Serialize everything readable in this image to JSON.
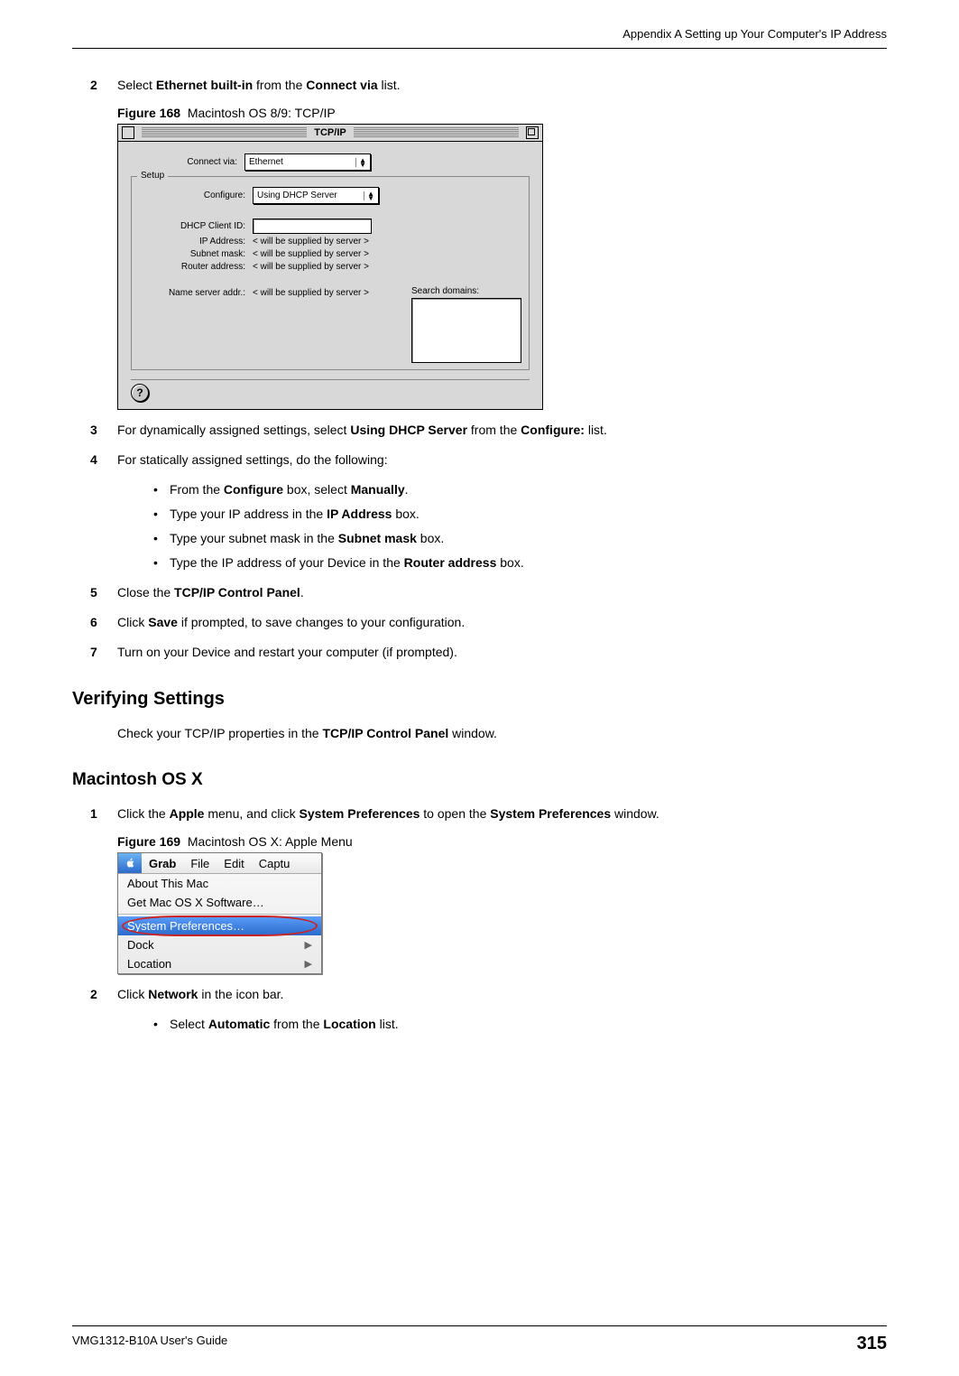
{
  "header": {
    "appendix": "Appendix A Setting up Your Computer's IP Address"
  },
  "steps": {
    "s2": {
      "num": "2",
      "pre": "Select ",
      "b1": "Ethernet built-in",
      "mid": " from the ",
      "b2": "Connect via",
      "post": " list."
    },
    "s3": {
      "num": "3",
      "pre": "For dynamically assigned settings, select ",
      "b1": "Using DHCP Server",
      "mid": " from the ",
      "b2": "Configure:",
      "post": " list."
    },
    "s4": {
      "num": "4",
      "text": "For statically assigned settings, do the following:"
    },
    "s5": {
      "num": "5",
      "pre": "Close the ",
      "b1": "TCP/IP Control Panel",
      "post": "."
    },
    "s6": {
      "num": "6",
      "pre": "Click ",
      "b1": "Save",
      "post": " if prompted, to save changes to your configuration."
    },
    "s7": {
      "num": "7",
      "text": "Turn on your Device and restart your computer (if prompted)."
    }
  },
  "bullets4": [
    {
      "pre": "From the ",
      "b1": "Configure",
      "mid": " box, select ",
      "b2": "Manually",
      "post": "."
    },
    {
      "pre": "Type your IP address in the ",
      "b1": "IP Address",
      "post": " box."
    },
    {
      "pre": "Type your subnet mask in the ",
      "b1": "Subnet mask",
      "post": " box."
    },
    {
      "pre": "Type the IP address of your Device in the ",
      "b1": "Router address",
      "post": " box."
    }
  ],
  "fig168": {
    "label": "Figure 168",
    "caption": "Macintosh OS 8/9: TCP/IP"
  },
  "mac89": {
    "title": "TCP/IP",
    "setup": "Setup",
    "labels": {
      "connect": "Connect via:",
      "configure": "Configure:",
      "dhcpid": "DHCP Client ID:",
      "ip": "IP Address:",
      "subnet": "Subnet mask:",
      "router": "Router address:",
      "ns": "Name server addr.:",
      "search": "Search domains:"
    },
    "values": {
      "connect": "Ethernet",
      "configure": "Using DHCP Server",
      "supplied": "< will be supplied by server >"
    },
    "help": "?"
  },
  "verifying": {
    "heading": "Verifying Settings",
    "text_pre": "Check your TCP/IP properties in the ",
    "text_b": "TCP/IP Control Panel",
    "text_post": " window."
  },
  "osx": {
    "heading": "Macintosh OS X",
    "s1": {
      "num": "1",
      "pre": "Click the ",
      "b1": "Apple",
      "mid1": " menu, and click ",
      "b2": "System Preferences",
      "mid2": " to open the ",
      "b3": "System Preferences",
      "post": " window."
    },
    "s2": {
      "num": "2",
      "pre": "Click ",
      "b1": "Network",
      "post": " in the icon bar."
    },
    "bullet": {
      "pre": "Select ",
      "b1": "Automatic",
      "mid": " from the ",
      "b2": "Location",
      "post": " list."
    }
  },
  "fig169": {
    "label": "Figure 169",
    "caption": "Macintosh OS X: Apple Menu"
  },
  "applemenu": {
    "bar": [
      "Grab",
      "File",
      "Edit",
      "Captu"
    ],
    "items": {
      "about": "About This Mac",
      "getsoft": "Get Mac OS X Software…",
      "sysprefs": "System Preferences…",
      "dock": "Dock",
      "location": "Location"
    }
  },
  "footer": {
    "guide": "VMG1312-B10A User's Guide",
    "page": "315"
  }
}
